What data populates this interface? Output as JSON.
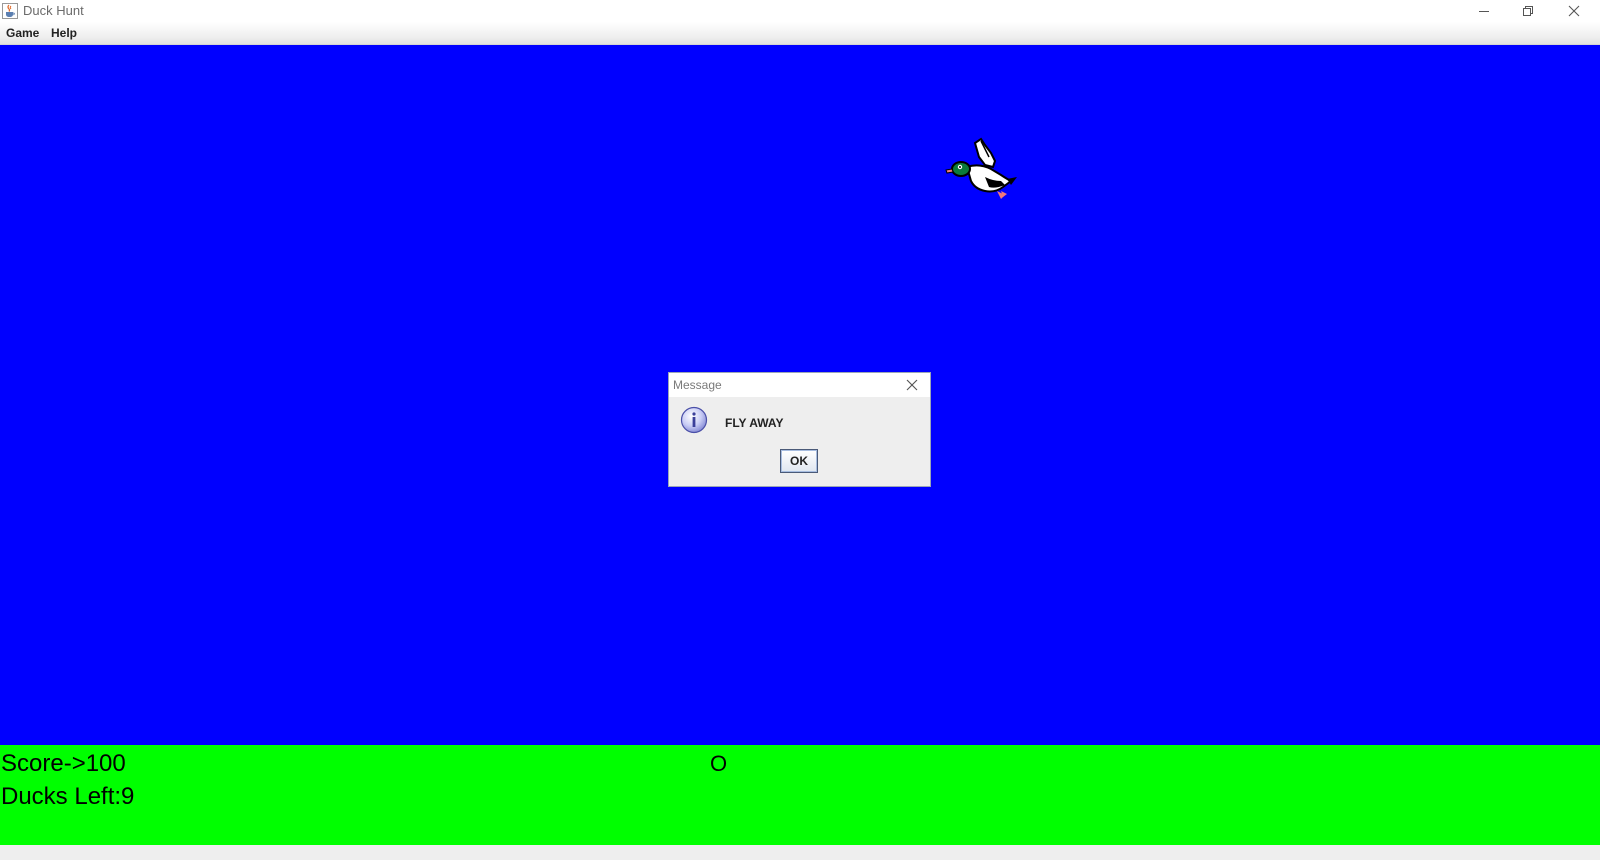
{
  "window": {
    "title": "Duck Hunt",
    "app_icon": "java-cup-icon",
    "controls": [
      "minimize-icon",
      "restore-icon",
      "close-icon"
    ]
  },
  "menubar": {
    "items": [
      {
        "label": "Game"
      },
      {
        "label": "Help"
      }
    ]
  },
  "game": {
    "sky_color": "#0000ff",
    "ground_color": "#00ff00",
    "duck_icon": "duck-icon",
    "score_text": "Score->100",
    "ducks_left_text": "Ducks Left:9",
    "cursor_marker": "O"
  },
  "dialog": {
    "title": "Message",
    "icon": "info-icon",
    "message": "FLY AWAY",
    "ok_label": "OK"
  }
}
